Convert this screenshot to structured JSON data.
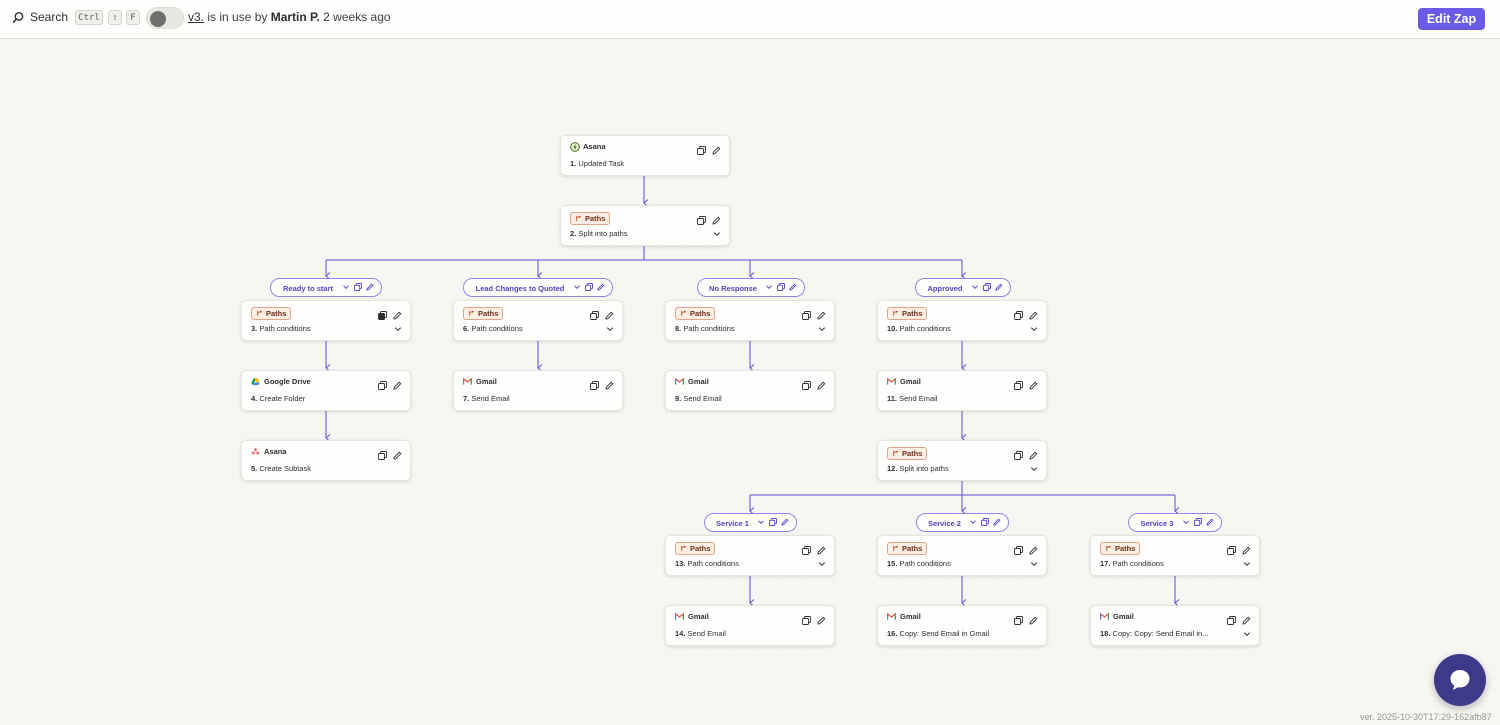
{
  "header": {
    "search_label": "Search",
    "shortcut": [
      "Ctrl",
      "⇧",
      "F"
    ],
    "toggle_state": "off",
    "version_link": "v3.",
    "status_middle": " is in use by ",
    "user": "Martin P.",
    "time_ago": " 2 weeks ago",
    "edit_button": "Edit Zap"
  },
  "steps": {
    "s1": {
      "app": "Asana",
      "num": "1.",
      "title": "Updated Task"
    },
    "s2": {
      "app": "Paths",
      "num": "2.",
      "title": "Split into paths"
    },
    "s3": {
      "app": "Paths",
      "num": "3.",
      "title": "Path conditions"
    },
    "s4": {
      "app": "Google Drive",
      "num": "4.",
      "title": "Create Folder"
    },
    "s5": {
      "app": "Asana",
      "num": "5.",
      "title": "Create Subtask"
    },
    "s6": {
      "app": "Paths",
      "num": "6.",
      "title": "Path conditions"
    },
    "s7": {
      "app": "Gmail",
      "num": "7.",
      "title": "Send Email"
    },
    "s8": {
      "app": "Paths",
      "num": "8.",
      "title": "Path conditions"
    },
    "s9": {
      "app": "Gmail",
      "num": "9.",
      "title": "Send Email"
    },
    "s10": {
      "app": "Paths",
      "num": "10.",
      "title": "Path conditions"
    },
    "s11": {
      "app": "Gmail",
      "num": "11.",
      "title": "Send Email"
    },
    "s12": {
      "app": "Paths",
      "num": "12.",
      "title": "Split into paths"
    },
    "s13": {
      "app": "Paths",
      "num": "13.",
      "title": "Path conditions"
    },
    "s14": {
      "app": "Gmail",
      "num": "14.",
      "title": "Send Email"
    },
    "s15": {
      "app": "Paths",
      "num": "15.",
      "title": "Path conditions"
    },
    "s16": {
      "app": "Gmail",
      "num": "16.",
      "title": "Copy: Send Email in Gmail"
    },
    "s17": {
      "app": "Paths",
      "num": "17.",
      "title": "Path conditions"
    },
    "s18": {
      "app": "Gmail",
      "num": "18.",
      "title": "Copy: Copy: Send Email in..."
    }
  },
  "path_labels": {
    "p1": "Ready to start",
    "p2": "Lead Changes to Quoted",
    "p3": "No Response",
    "p4": "Approved",
    "p5": "Service 1",
    "p6": "Service 2",
    "p7": "Service 3"
  },
  "footer": {
    "version": "ver. 2025-10-30T17:29-162afb87"
  },
  "colors": {
    "accent": "#695be8",
    "connector": "#5a4fd6",
    "paths_badge": "#fdeee6",
    "chat": "#3e3a8a"
  },
  "icons": {
    "search": "search-icon",
    "copy": "copy-icon",
    "edit": "pencil-icon",
    "expand": "chevron-down-icon",
    "trigger": "trigger-bolt-icon",
    "asana": "asana-logo-icon",
    "gmail": "gmail-logo-icon",
    "drive": "google-drive-logo-icon",
    "paths": "paths-icon",
    "chat": "chat-bubble-icon"
  }
}
